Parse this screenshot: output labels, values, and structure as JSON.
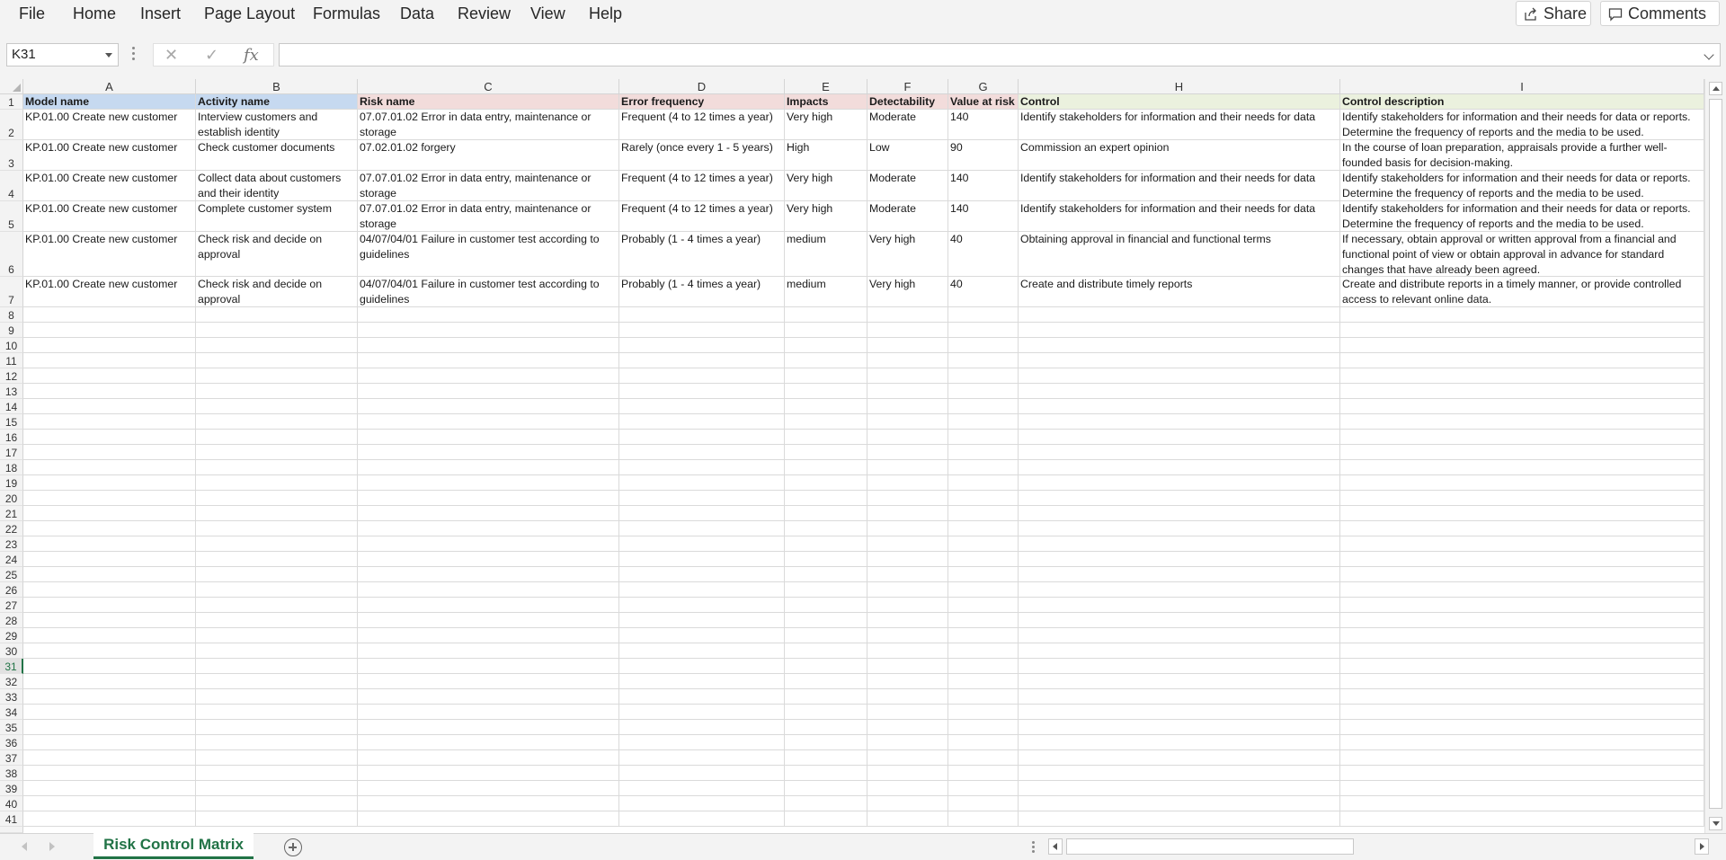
{
  "menu": {
    "tabs": [
      "File",
      "Home",
      "Insert",
      "Page Layout",
      "Formulas",
      "Data",
      "Review",
      "View",
      "Help"
    ],
    "share_label": "Share",
    "comments_label": "Comments"
  },
  "formula_bar": {
    "name_box": "K31",
    "formula": ""
  },
  "grid": {
    "columns": [
      "A",
      "B",
      "C",
      "D",
      "E",
      "F",
      "G",
      "H",
      "I"
    ],
    "header_colors": [
      "#c6d9f0",
      "#c6d9f0",
      "#f2dcdb",
      "#f2dcdb",
      "#f2dcdb",
      "#f2dcdb",
      "#f2dcdb",
      "#ebf1de",
      "#ebf1de"
    ],
    "headers": [
      "Model name",
      "Activity name",
      "Risk name",
      "Error frequency",
      "Impacts",
      "Detectability",
      "Value at risk",
      "Control",
      "Control description"
    ],
    "rows": [
      [
        "KP.01.00 Create new customer",
        "Interview customers and establish identity",
        "07.07.01.02 Error in data entry, maintenance or storage",
        "Frequent (4 to 12 times a year)",
        "Very high",
        "Moderate",
        "140",
        "Identify stakeholders for information and their needs for data",
        "Identify stakeholders for information and their needs for data or reports. Determine the frequency of reports and the media to be used."
      ],
      [
        "KP.01.00 Create new customer",
        "Check customer documents",
        "07.02.01.02 forgery",
        "Rarely (once every 1 - 5 years)",
        "High",
        "Low",
        "90",
        "Commission an expert opinion",
        "In the course of loan preparation, appraisals provide a further well-founded basis for decision-making."
      ],
      [
        "KP.01.00 Create new customer",
        "Collect data about customers and their identity",
        "07.07.01.02 Error in data entry, maintenance or storage",
        "Frequent (4 to 12 times a year)",
        "Very high",
        "Moderate",
        "140",
        "Identify stakeholders for information and their needs for data",
        "Identify stakeholders for information and their needs for data or reports. Determine the frequency of reports and the media to be used."
      ],
      [
        "KP.01.00 Create new customer",
        "Complete customer system",
        "07.07.01.02 Error in data entry, maintenance or storage",
        "Frequent (4 to 12 times a year)",
        "Very high",
        "Moderate",
        "140",
        "Identify stakeholders for information and their needs for data",
        "Identify stakeholders for information and their needs for data or reports. Determine the frequency of reports and the media to be used."
      ],
      [
        "KP.01.00 Create new customer",
        "Check risk and decide on approval",
        "04/07/04/01 Failure in customer test according to guidelines",
        "Probably (1 - 4 times a year)",
        "medium",
        "Very high",
        "40",
        "Obtaining approval in financial and functional terms",
        "If necessary, obtain approval or written approval from a financial and functional point of view or obtain approval in advance for standard changes that have already been agreed."
      ],
      [
        "KP.01.00 Create new customer",
        "Check risk and decide on approval",
        "04/07/04/01 Failure in customer test according to guidelines",
        "Probably (1 - 4 times a year)",
        "medium",
        "Very high",
        "40",
        "Create and distribute timely reports",
        "Create and distribute reports in a timely manner, or provide controlled access to relevant online data."
      ]
    ],
    "row_numbers": [
      "1",
      "2",
      "3",
      "4",
      "5",
      "6",
      "7",
      "8",
      "9",
      "10",
      "11",
      "12",
      "13",
      "14",
      "15",
      "16",
      "17",
      "18",
      "19",
      "20",
      "21",
      "22",
      "23",
      "24",
      "25",
      "26",
      "27",
      "28",
      "29",
      "30",
      "31",
      "32",
      "33",
      "34",
      "35",
      "36",
      "37",
      "38",
      "39",
      "40",
      "41"
    ],
    "selected_row": "31"
  },
  "sheets": {
    "active": "Risk Control Matrix"
  }
}
